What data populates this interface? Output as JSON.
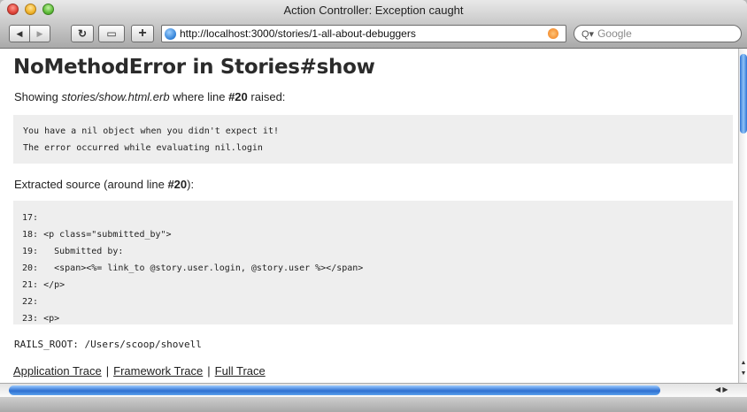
{
  "window": {
    "title": "Action Controller: Exception caught"
  },
  "toolbar": {
    "back_icon": "◀",
    "forward_icon": "▶",
    "reload_icon": "↻",
    "snap_icon": "▭",
    "add_icon": "+",
    "url": "http://localhost:3000/stories/1-all-about-debuggers"
  },
  "search": {
    "placeholder": "Google",
    "glyph": "Q▾"
  },
  "page": {
    "title": "NoMethodError in Stories#show",
    "showing_prefix": "Showing ",
    "template_path": "stories/show.html.erb",
    "showing_mid": " where line ",
    "line_number": "#20",
    "showing_suffix": " raised:",
    "error_lines": [
      "You have a nil object when you didn't expect it!",
      "The error occurred while evaluating nil.login"
    ],
    "extracted_prefix": "Extracted source (around line ",
    "extracted_line": "#20",
    "extracted_suffix": "):",
    "source_lines": [
      "17:",
      "18: <p class=\"submitted_by\">",
      "19:   Submitted by:",
      "20:   <span><%= link_to @story.user.login, @story.user %></span>",
      "21: </p>",
      "22:",
      "23: <p>"
    ],
    "rails_root": "RAILS_ROOT: /Users/scoop/shovell",
    "traces": [
      "Application Trace",
      "Framework Trace",
      "Full Trace"
    ],
    "trace_separator": "|"
  }
}
